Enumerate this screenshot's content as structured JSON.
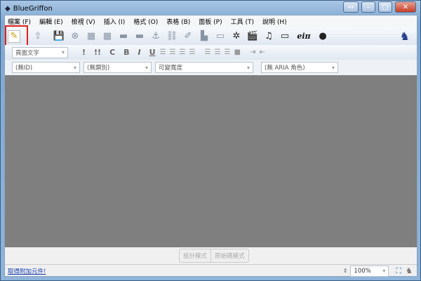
{
  "window": {
    "title": "BlueGriffon"
  },
  "menu": [
    "檔案 (F)",
    "編輯 (E)",
    "檢視 (V)",
    "插入 (I)",
    "格式 (O)",
    "表格 (B)",
    "面板 (P)",
    "工具 (T)",
    "說明 (H)"
  ],
  "toolbar": {
    "icons": [
      "edit-pencil-icon",
      "publish-icon",
      "save-icon",
      "close-doc-icon",
      "table-icon",
      "table2-icon",
      "image-icon",
      "image2-icon",
      "anchor-icon",
      "link-icon",
      "form-icon",
      "chart-icon",
      "css-icon",
      "spell-icon",
      "video-icon",
      "audio-icon",
      "window-icon",
      "math-icon",
      "globe-icon"
    ],
    "math_label": "eiπ"
  },
  "format": {
    "paragraph_select": "頁面文字",
    "buttons": [
      "!",
      "!!",
      "C",
      "B",
      "I",
      "U"
    ]
  },
  "selectors": {
    "id": "(無ID)",
    "class": "(無類別)",
    "width": "可變寬度",
    "aria": "(無 ARIA 角色)"
  },
  "modes": [
    "設計模式",
    "原始碼模式"
  ],
  "status": {
    "addons_link": "取得附加元件!",
    "zoom": "100%"
  },
  "highlight_color": "#e02020"
}
